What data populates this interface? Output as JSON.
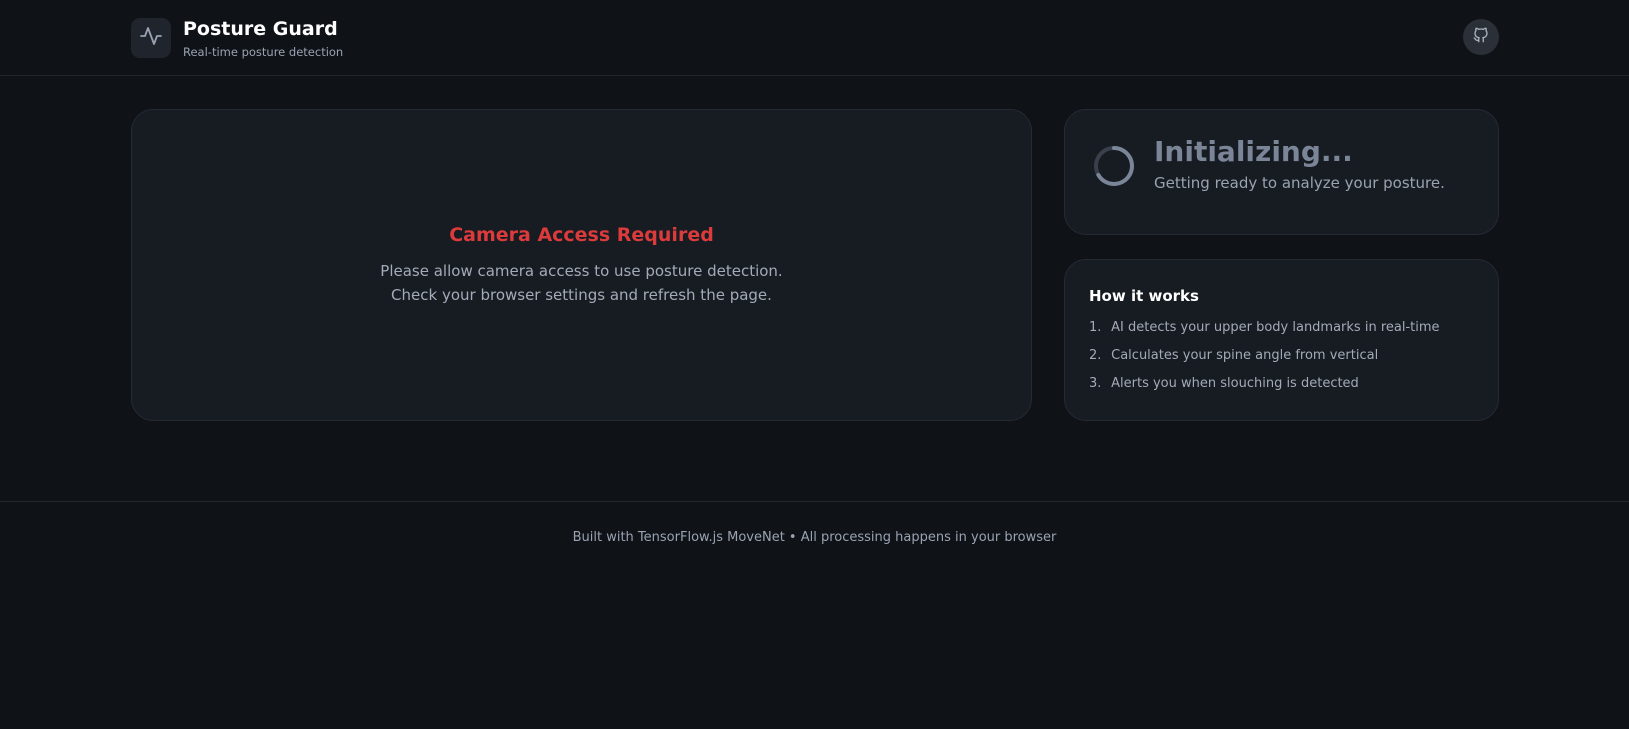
{
  "header": {
    "title": "Posture Guard",
    "subtitle": "Real-time posture detection",
    "logo_icon": "activity-pulse-icon",
    "github_icon": "github-icon"
  },
  "camera": {
    "title": "Camera Access Required",
    "line1": "Please allow camera access to use posture detection.",
    "line2": "Check your browser settings and refresh the page."
  },
  "status": {
    "title": "Initializing...",
    "text": "Getting ready to analyze your posture.",
    "icon": "loading-spinner-icon"
  },
  "how_it_works": {
    "title": "How it works",
    "steps": [
      {
        "num": "1.",
        "text": "AI detects your upper body landmarks in real-time"
      },
      {
        "num": "2.",
        "text": "Calculates your spine angle from vertical"
      },
      {
        "num": "3.",
        "text": "Alerts you when slouching is detected"
      }
    ]
  },
  "footer": {
    "text": "Built with TensorFlow.js MoveNet • All processing happens in your browser"
  },
  "colors": {
    "background": "#0f1217",
    "card": "#171b22",
    "error": "#dc3b3b",
    "muted": "#9aa3b2"
  }
}
